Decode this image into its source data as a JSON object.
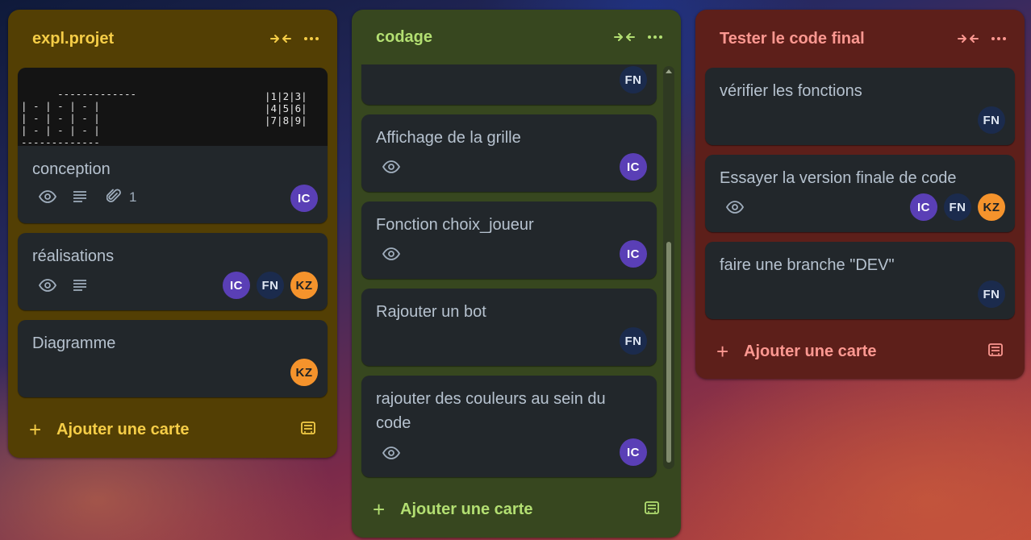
{
  "colors": {
    "list_yellow": "#533f04",
    "list_green": "#37471f",
    "list_red": "#5d1f1a",
    "accent_yellow": "#f5cd47",
    "accent_green": "#b3df72",
    "accent_red": "#fd9891",
    "card_bg": "#22272b",
    "card_text": "#b6c2cf"
  },
  "lists": [
    {
      "title": "expl.projet",
      "collapse_icon": "collapse-arrows-icon",
      "menu_icon": "more-dots-icon",
      "add_card_label": "Ajouter une carte",
      "template_icon": "card-template-icon",
      "cards": [
        {
          "title": "conception",
          "cover_ascii_left": "-------------\n| - | - | - |\n| - | - | - |\n| - | - | - |\n-------------",
          "cover_ascii_right": "|1|2|3|\n|4|5|6|\n|7|8|9|",
          "badges": {
            "watch": "eye-icon",
            "description": "description-icon",
            "attachment": "paperclip-icon",
            "attachment_count": "1"
          },
          "members": [
            "IC"
          ]
        },
        {
          "title": "réalisations",
          "badges": {
            "watch": "eye-icon",
            "description": "description-icon"
          },
          "members": [
            "IC",
            "FN",
            "KZ"
          ]
        },
        {
          "title": "Diagramme",
          "members": [
            "KZ"
          ]
        }
      ]
    },
    {
      "title": "codage",
      "collapse_icon": "collapse-arrows-icon",
      "menu_icon": "more-dots-icon",
      "add_card_label": "Ajouter une carte",
      "template_icon": "card-template-icon",
      "cards": [
        {
          "title": "",
          "members": [
            "FN"
          ]
        },
        {
          "title": "Affichage de la grille",
          "badges": {
            "watch": "eye-icon"
          },
          "members": [
            "IC"
          ]
        },
        {
          "title": "Fonction choix_joueur",
          "badges": {
            "watch": "eye-icon"
          },
          "members": [
            "IC"
          ]
        },
        {
          "title": "Rajouter un bot",
          "members": [
            "FN"
          ]
        },
        {
          "title": "rajouter des couleurs au sein du code",
          "badges": {
            "watch": "eye-icon"
          },
          "members": [
            "IC"
          ]
        }
      ]
    },
    {
      "title": "Tester le code final",
      "collapse_icon": "collapse-arrows-icon",
      "menu_icon": "more-dots-icon",
      "add_card_label": "Ajouter une carte",
      "template_icon": "card-template-icon",
      "cards": [
        {
          "title": "vérifier les fonctions",
          "members": [
            "FN"
          ]
        },
        {
          "title": "Essayer la version finale de code",
          "badges": {
            "watch": "eye-icon"
          },
          "members": [
            "IC",
            "FN",
            "KZ"
          ]
        },
        {
          "title": "faire une branche \"DEV\"",
          "members": [
            "FN"
          ]
        }
      ]
    }
  ]
}
